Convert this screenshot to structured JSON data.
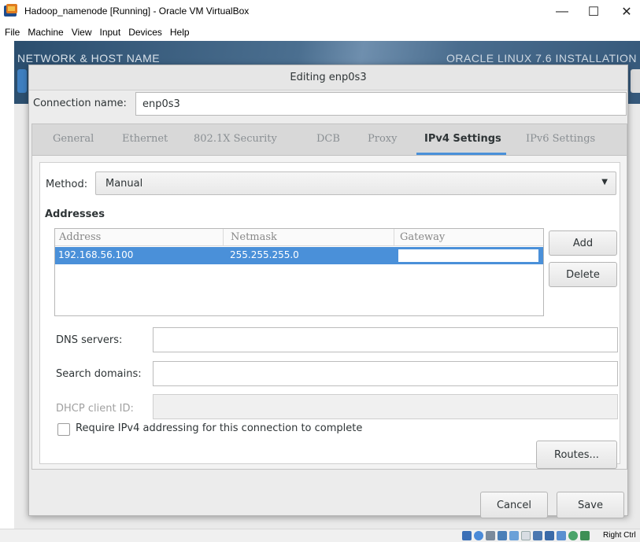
{
  "window": {
    "title": "Hadoop_namenode [Running] - Oracle VM VirtualBox",
    "minimize": "—",
    "maximize": "☐",
    "close": "✕"
  },
  "menu": [
    "File",
    "Machine",
    "View",
    "Input",
    "Devices",
    "Help"
  ],
  "installer": {
    "left_title": "NETWORK & HOST NAME",
    "right_title": "ORACLE LINUX 7.6 INSTALLATION"
  },
  "dialog": {
    "title": "Editing enp0s3",
    "connection_label": "Connection name:",
    "connection_value": "enp0s3",
    "tabs": [
      {
        "label": "General",
        "active": false
      },
      {
        "label": "Ethernet",
        "active": false
      },
      {
        "label": "802.1X Security",
        "active": false
      },
      {
        "label": "DCB",
        "active": false
      },
      {
        "label": "Proxy",
        "active": false
      },
      {
        "label": "IPv4 Settings",
        "active": true
      },
      {
        "label": "IPv6 Settings",
        "active": false
      }
    ],
    "method_label": "Method:",
    "method_value": "Manual",
    "addresses_heading": "Addresses",
    "columns": [
      "Address",
      "Netmask",
      "Gateway"
    ],
    "rows": [
      {
        "address": "192.168.56.100",
        "netmask": "255.255.255.0",
        "gateway": ""
      }
    ],
    "add_label": "Add",
    "delete_label": "Delete",
    "dns_label": "DNS servers:",
    "dns_value": "",
    "search_label": "Search domains:",
    "search_value": "",
    "dhcp_label": "DHCP client ID:",
    "dhcp_value": "",
    "require_label": "Require IPv4 addressing for this connection to complete",
    "require_checked": false,
    "routes_label": "Routes...",
    "cancel_label": "Cancel",
    "save_label": "Save"
  },
  "statusbar": {
    "host_key": "Right Ctrl",
    "tray_icons": [
      "hard-disk-icon",
      "optical-drive-icon",
      "audio-icon",
      "network-icon",
      "usb-icon",
      "shared-folder-icon",
      "display-icon",
      "recording-icon",
      "cpu-icon",
      "mouse-integration-icon",
      "keyboard-icon"
    ]
  },
  "colors": {
    "accent": "#4a90d9",
    "header": "#3e6384"
  }
}
